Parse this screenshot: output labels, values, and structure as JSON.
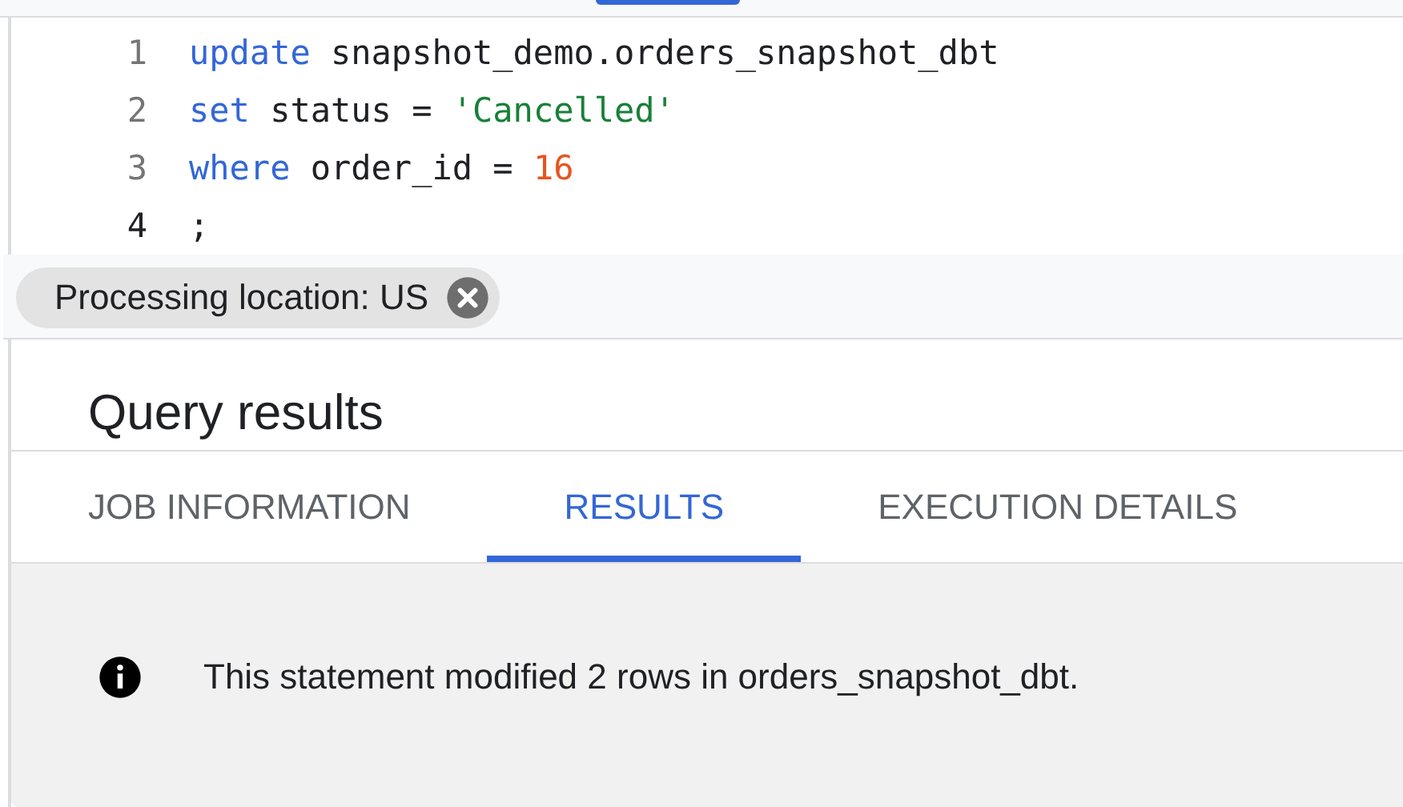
{
  "editor": {
    "lines": [
      {
        "number": "1",
        "active": false,
        "tokens": [
          {
            "kind": "keyword",
            "text": "update"
          },
          {
            "kind": "plain",
            "text": " snapshot_demo.orders_snapshot_dbt"
          }
        ]
      },
      {
        "number": "2",
        "active": false,
        "tokens": [
          {
            "kind": "keyword",
            "text": "set"
          },
          {
            "kind": "plain",
            "text": " status = "
          },
          {
            "kind": "string",
            "text": "'Cancelled'"
          }
        ]
      },
      {
        "number": "3",
        "active": false,
        "tokens": [
          {
            "kind": "keyword",
            "text": "where"
          },
          {
            "kind": "plain",
            "text": " order_id = "
          },
          {
            "kind": "number",
            "text": "16"
          }
        ]
      },
      {
        "number": "4",
        "active": true,
        "tokens": [
          {
            "kind": "plain",
            "text": ";"
          }
        ]
      }
    ]
  },
  "location_chip": {
    "label": "Processing location: US"
  },
  "results": {
    "title": "Query results",
    "tabs": [
      {
        "label": "JOB INFORMATION",
        "selected": false
      },
      {
        "label": "RESULTS",
        "selected": true
      },
      {
        "label": "EXECUTION DETAILS",
        "selected": false
      }
    ],
    "message": "This statement modified 2 rows in orders_snapshot_dbt."
  }
}
